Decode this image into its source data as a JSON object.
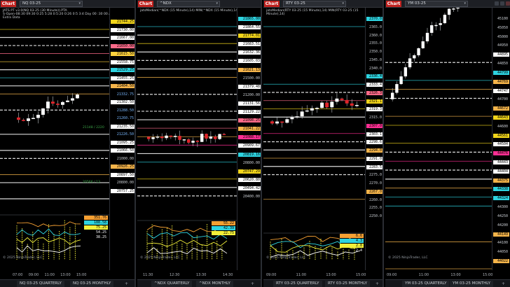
{
  "panels": [
    {
      "tab_label": "Chart",
      "instrument": "NQ 03-25",
      "header_lines": [
        "JATS PT v3.0(NQ 03-25 (30 Minute)).PTA",
        "S-Open-08:30 09:30 0:25 5:28 0:5:20 0:26 0:5 3:4 Day 00 :30 00 Auto",
        "Extra Data"
      ],
      "price_labels": [
        {
          "text": "21744.25",
          "bg": "#f2d51b",
          "fg": "#000"
        },
        {
          "text": "21730.00",
          "bg": "#ffffff",
          "fg": "#000"
        },
        {
          "text": "21667.00",
          "bg": "#ffffff",
          "fg": "#000"
        },
        {
          "text": "21650.00",
          "bg": "#fd6a89",
          "fg": "#000"
        },
        {
          "text": "21615.50",
          "bg": "#ffd33d",
          "fg": "#000"
        },
        {
          "text": "21558.75",
          "bg": "#ffffff",
          "fg": "#000"
        },
        {
          "text": "21529.25",
          "bg": "#2ed3e0",
          "fg": "#000"
        },
        {
          "text": "21455.25",
          "bg": "#ffffff",
          "fg": "#000"
        },
        {
          "text": "21404.50",
          "bg": "#f5b44a",
          "fg": "#000"
        },
        {
          "text": "21332.75",
          "bg": "",
          "fg": "#7ab8ff"
        },
        {
          "text": "21302.50",
          "bg": "#ffffff",
          "fg": "#000"
        },
        {
          "text": "21288.50",
          "bg": "",
          "fg": "#7ab8ff"
        },
        {
          "text": "21260.75",
          "bg": "",
          "fg": "#7ab8ff"
        },
        {
          "text": "21235.50",
          "bg": "#ffffff",
          "fg": "#000"
        },
        {
          "text": "21226.50",
          "bg": "",
          "fg": "#7ab8ff"
        },
        {
          "text": "21095.25",
          "bg": "#ffffff",
          "fg": "#000"
        },
        {
          "text": "21066.50",
          "bg": "#ffffff",
          "fg": "#000"
        },
        {
          "text": "21000.00",
          "bg": "",
          "fg": "#c9cdd2"
        },
        {
          "text": "20926.25",
          "bg": "#f5b44a",
          "fg": "#000"
        },
        {
          "text": "20897.50",
          "bg": "#ffffff",
          "fg": "#000"
        },
        {
          "text": "20800.00",
          "bg": "",
          "fg": "#c9cdd2"
        },
        {
          "text": "20757.25",
          "bg": "#ffffff",
          "fg": "#000"
        }
      ],
      "annotations": [
        "21148 / 2220",
        "20566 / 13"
      ],
      "sub_labels": [
        {
          "text": "351.76",
          "bg": "#f5a033",
          "fg": "#000"
        },
        {
          "text": "188.58",
          "bg": "#2ed3e0",
          "fg": "#000"
        },
        {
          "text": "75.25",
          "bg": "#f2ef3a",
          "fg": "#000"
        },
        {
          "text": "54.25",
          "bg": "",
          "fg": "#ffffff"
        },
        {
          "text": "38.25",
          "bg": "",
          "fg": "#ffffff"
        }
      ],
      "time_ticks": [
        "07:00",
        "09:00",
        "11:00",
        "13:00",
        "15:00"
      ],
      "copyright": "© 2025 NinjaTrader, LLC",
      "bottom_tabs": [
        "NQ 03-25 QUARTERLY",
        "NQ 03-25 MONTHLY"
      ]
    },
    {
      "tab_label": "Chart",
      "instrument": "^NDX",
      "header_lines": [
        "jatsMedian(^NDX (15 Minute),14)  MIN(^NDX (15 Minute),14)"
      ],
      "price_labels": [
        {
          "text": "21865.00",
          "bg": "#2ed3e0",
          "fg": "#000"
        },
        {
          "text": "21864.55",
          "bg": "#ffffff",
          "fg": "#000"
        },
        {
          "text": "21774.01",
          "bg": "#f2d51b",
          "fg": "#000"
        },
        {
          "text": "21683.51",
          "bg": "#ffffff",
          "fg": "#000"
        },
        {
          "text": "21632.36",
          "bg": "#ffffff",
          "fg": "#000"
        },
        {
          "text": "21605.03",
          "bg": "#ffffff",
          "fg": "#000"
        },
        {
          "text": "21621.13",
          "bg": "#f5b44a",
          "fg": "#000"
        },
        {
          "text": "21500.00",
          "bg": "",
          "fg": "#c9cdd2"
        },
        {
          "text": "21379.48",
          "bg": "#ffffff",
          "fg": "#000"
        },
        {
          "text": "21200.00",
          "bg": "",
          "fg": "#c9cdd2"
        },
        {
          "text": "21131.56",
          "bg": "#ffffff",
          "fg": "#000"
        },
        {
          "text": "21129.22",
          "bg": "#ffffff",
          "fg": "#000"
        },
        {
          "text": "21098.25",
          "bg": "#fd6a89",
          "fg": "#000"
        },
        {
          "text": "21041.22",
          "bg": "#f5b44a",
          "fg": "#000"
        },
        {
          "text": "21088.17",
          "bg": "#ff2f93",
          "fg": "#000"
        },
        {
          "text": "20909.67",
          "bg": "#ffffff",
          "fg": "#000"
        },
        {
          "text": "20819.16",
          "bg": "#2ed3e0",
          "fg": "#000"
        },
        {
          "text": "20800.00",
          "bg": "",
          "fg": "#c9cdd2"
        },
        {
          "text": "20747.29",
          "bg": "#f2d51b",
          "fg": "#000"
        },
        {
          "text": "20620.80",
          "bg": "#ffffff",
          "fg": "#000"
        },
        {
          "text": "20494.42",
          "bg": "#ffffff",
          "fg": "#000"
        },
        {
          "text": "20400.00",
          "bg": "",
          "fg": "#c9cdd2"
        }
      ],
      "sub_labels": [
        {
          "text": "55.22",
          "bg": "#f5a033",
          "fg": "#000"
        },
        {
          "text": "42.39",
          "bg": "#2ed3e0",
          "fg": "#000"
        },
        {
          "text": "22.75",
          "bg": "#f2ef3a",
          "fg": "#000"
        }
      ],
      "time_ticks": [
        "11:30",
        "12:30",
        "13:30",
        "14:30"
      ],
      "copyright": "© 2025 NinjaTrader, LLC",
      "bottom_tabs": [
        "^NDX QUARTERLY",
        "^NDX MONTHLY"
      ]
    },
    {
      "tab_label": "Chart",
      "instrument": "RTY 03-25",
      "header_lines": [
        "jatsMedian(RTY 03-25 (15 Minute),14)  MIN(RTY 03-25 (15",
        "Minute),14)"
      ],
      "price_labels": [
        {
          "text": "2370.0",
          "bg": "#2ed3e0",
          "fg": "#000"
        },
        {
          "text": "2365.0",
          "bg": "",
          "fg": "#c9cdd2"
        },
        {
          "text": "2360.0",
          "bg": "",
          "fg": "#c9cdd2"
        },
        {
          "text": "2355.0",
          "bg": "",
          "fg": "#c9cdd2"
        },
        {
          "text": "2350.0",
          "bg": "",
          "fg": "#c9cdd2"
        },
        {
          "text": "2345.0",
          "bg": "",
          "fg": "#c9cdd2"
        },
        {
          "text": "2340.0",
          "bg": "",
          "fg": "#c9cdd2"
        },
        {
          "text": "2336.4",
          "bg": "#2ed3e0",
          "fg": "#000"
        },
        {
          "text": "2333.4",
          "bg": "#ffffff",
          "fg": "#000"
        },
        {
          "text": "2326.3",
          "bg": "#fd6a89",
          "fg": "#000"
        },
        {
          "text": "2321.1",
          "bg": "#f2d51b",
          "fg": "#000"
        },
        {
          "text": "2319.3",
          "bg": "#ffffff",
          "fg": "#000"
        },
        {
          "text": "2315.0",
          "bg": "",
          "fg": "#c9cdd2"
        },
        {
          "text": "2307.0",
          "bg": "#ff2f93",
          "fg": "#000"
        },
        {
          "text": "2303.1",
          "bg": "#ffffff",
          "fg": "#000"
        },
        {
          "text": "2298.6",
          "bg": "#ffffff",
          "fg": "#000"
        },
        {
          "text": "2294.0",
          "bg": "#f5b44a",
          "fg": "#000"
        },
        {
          "text": "2291.0",
          "bg": "#ffffff",
          "fg": "#000"
        },
        {
          "text": "2283.5",
          "bg": "#ffffff",
          "fg": "#000"
        },
        {
          "text": "2275.0",
          "bg": "",
          "fg": "#c9cdd2"
        },
        {
          "text": "2270.0",
          "bg": "",
          "fg": "#c9cdd2"
        },
        {
          "text": "2267.0",
          "bg": "#f5b44a",
          "fg": "#000"
        },
        {
          "text": "2260.0",
          "bg": "",
          "fg": "#c9cdd2"
        },
        {
          "text": "2255.0",
          "bg": "",
          "fg": "#c9cdd2"
        },
        {
          "text": "2250.0",
          "bg": "",
          "fg": "#c9cdd2"
        }
      ],
      "sub_labels": [
        {
          "text": "6.6",
          "bg": "#f5a033",
          "fg": "#000"
        },
        {
          "text": "4.3",
          "bg": "#2ed3e0",
          "fg": "#000"
        },
        {
          "text": "2.8",
          "bg": "#f2ef3a",
          "fg": "#000"
        },
        {
          "text": "2.4",
          "bg": "",
          "fg": "#ffffff"
        }
      ],
      "time_ticks": [
        "09:00",
        "11:00",
        "13:00",
        "15:00"
      ],
      "copyright": "© 2025 NinjaTrader, LLC",
      "bottom_tabs": [
        "RTY 03-25 QUARTERLY",
        "RTY 03-25 MONTHLY"
      ]
    },
    {
      "tab_label": "Chart",
      "instrument": "YM 03-25",
      "header_lines": [],
      "price_labels": [
        {
          "text": "45100",
          "bg": "",
          "fg": "#c9cdd2"
        },
        {
          "text": "45050",
          "bg": "",
          "fg": "#c9cdd2"
        },
        {
          "text": "45000",
          "bg": "",
          "fg": "#c9cdd2"
        },
        {
          "text": "44950",
          "bg": "",
          "fg": "#c9cdd2"
        },
        {
          "text": "44895",
          "bg": "#ffffff",
          "fg": "#000"
        },
        {
          "text": "44850",
          "bg": "",
          "fg": "#c9cdd2"
        },
        {
          "text": "44799",
          "bg": "#2ed3e0",
          "fg": "#000"
        },
        {
          "text": "44769",
          "bg": "#f5b44a",
          "fg": "#000"
        },
        {
          "text": "44747",
          "bg": "#ffffff",
          "fg": "#000"
        },
        {
          "text": "44700",
          "bg": "",
          "fg": "#c9cdd2"
        },
        {
          "text": "44672",
          "bg": "#f5b44a",
          "fg": "#000"
        },
        {
          "text": "44643",
          "bg": "#f2d51b",
          "fg": "#000"
        },
        {
          "text": "44600",
          "bg": "",
          "fg": "#c9cdd2"
        },
        {
          "text": "44561",
          "bg": "#f2d51b",
          "fg": "#000"
        },
        {
          "text": "44504",
          "bg": "#ffffff",
          "fg": "#000"
        },
        {
          "text": "44476",
          "bg": "#ff2f93",
          "fg": "#000"
        },
        {
          "text": "44443",
          "bg": "#ffffff",
          "fg": "#000"
        },
        {
          "text": "44404",
          "bg": "#ffffff",
          "fg": "#000"
        },
        {
          "text": "44375",
          "bg": "#f5b44a",
          "fg": "#000"
        },
        {
          "text": "44338",
          "bg": "#2ed3e0",
          "fg": "#000"
        },
        {
          "text": "44324",
          "bg": "#2ed3e0",
          "fg": "#000"
        },
        {
          "text": "44300",
          "bg": "",
          "fg": "#c9cdd2"
        },
        {
          "text": "44250",
          "bg": "",
          "fg": "#c9cdd2"
        },
        {
          "text": "44200",
          "bg": "",
          "fg": "#c9cdd2"
        },
        {
          "text": "44149",
          "bg": "#f5b44a",
          "fg": "#000"
        },
        {
          "text": "44100",
          "bg": "",
          "fg": "#c9cdd2"
        },
        {
          "text": "44050",
          "bg": "",
          "fg": "#c9cdd2"
        },
        {
          "text": "44022",
          "bg": "#f5b44a",
          "fg": "#000"
        }
      ],
      "sub_labels": [],
      "time_ticks": [
        "09:00",
        "11:00",
        "13:00",
        "15:00"
      ],
      "copyright": "© 2025 NinjaTrader, LLC",
      "bottom_tabs": [
        "YM 03-25 QUARTERLY",
        "YM 03-25 MONTHLY"
      ]
    }
  ],
  "colors": {
    "up_candle": "#ffffff",
    "down_candle": "#e0242a",
    "orange": "#f5a033",
    "cyan": "#2ed3e0",
    "yellow": "#f2ef3a",
    "magenta": "#ff2f93"
  }
}
